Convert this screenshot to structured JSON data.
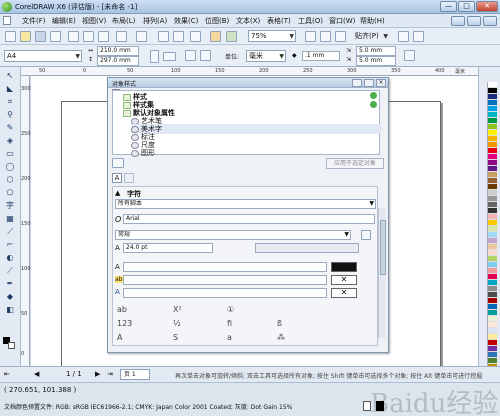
{
  "window": {
    "title": "CorelDRAW X6 (评估版) - [未命名 -1]",
    "buttons": {
      "minimize": "—",
      "maximize": "□",
      "close": "✕"
    }
  },
  "menu": [
    "文件(F)",
    "编辑(E)",
    "视图(V)",
    "布局(L)",
    "排列(A)",
    "效果(C)",
    "位图(B)",
    "文本(X)",
    "表格(T)",
    "工具(O)",
    "窗口(W)",
    "帮助(H)"
  ],
  "std_toolbar": {
    "zoom": "75%",
    "snap": "贴齐(P)"
  },
  "property_bar": {
    "page_size": "A4",
    "width": "210.0 mm",
    "height": "297.0 mm",
    "units_label": "单位:",
    "units": "毫米",
    "nudge": ".1 mm",
    "dup_x": "5.0 mm",
    "dup_y": "5.0 mm"
  },
  "ruler": {
    "h_labels": [
      "50",
      "0",
      "50",
      "100",
      "150",
      "200",
      "250",
      "300",
      "350",
      "400"
    ],
    "v_labels": [
      "300",
      "250",
      "200",
      "150",
      "100",
      "50",
      "0"
    ],
    "unit": "毫米"
  },
  "docker": {
    "title": "对象样式",
    "tree": [
      {
        "label": "样式",
        "level": 0
      },
      {
        "label": "样式集",
        "level": 0
      },
      {
        "label": "默认对象属性",
        "level": 0
      },
      {
        "label": "艺术笔",
        "level": 1
      },
      {
        "label": "美术字",
        "level": 1
      },
      {
        "label": "标注",
        "level": 1
      },
      {
        "label": "尺度",
        "level": 1
      },
      {
        "label": "图形",
        "level": 1
      }
    ],
    "apply_button": "应用于选定对象",
    "section_char": "字符",
    "script": "所有脚本",
    "font": "Arial",
    "font_style": "常规",
    "font_size": "24.0 pt"
  },
  "pagebar": {
    "page_count": "1 / 1",
    "page_tab": "页 1"
  },
  "status": {
    "coords": "( 270.651, 101.388 )",
    "hint": "再次单击对象可旋转/倾斜; 双击工具可选择所有对象; 按住 Shift 键单击可选择多个对象; 按住 Alt 键单击可进行挖掘",
    "color_profile": "文档颜色预置文件: RGB: sRGB IEC61966-2.1; CMYK: Japan Color 2001 Coated; 灰度: Dot Gain 15%",
    "watermark": "Baidu经验"
  },
  "palette_colors": [
    "#ffffff",
    "#000000",
    "#1b2b7a",
    "#0070c0",
    "#00a0e9",
    "#00b7c3",
    "#009944",
    "#8fc31f",
    "#fff100",
    "#f8b500",
    "#f39800",
    "#e60012",
    "#e4007f",
    "#920783",
    "#601986",
    "#c9a063",
    "#946134",
    "#6a3906",
    "#cccccc",
    "#999999",
    "#666666",
    "#333333",
    "#f5b2b2",
    "#fcc800",
    "#d7e9a5",
    "#9fd9f6",
    "#c2a4cf",
    "#e8c59c",
    "#f7dbd2",
    "#b3d465",
    "#7ecef4",
    "#f29c9f",
    "#e5004f",
    "#00a7c2",
    "#8e8e8e",
    "#4d4d4d",
    "#a40000",
    "#0068b7",
    "#009e96",
    "#eaf0d4",
    "#fde9d9",
    "#dbe5f1",
    "#ffeb9c",
    "#c00000",
    "#7030a0",
    "#2e75b6",
    "#548235",
    "#bf9000"
  ]
}
